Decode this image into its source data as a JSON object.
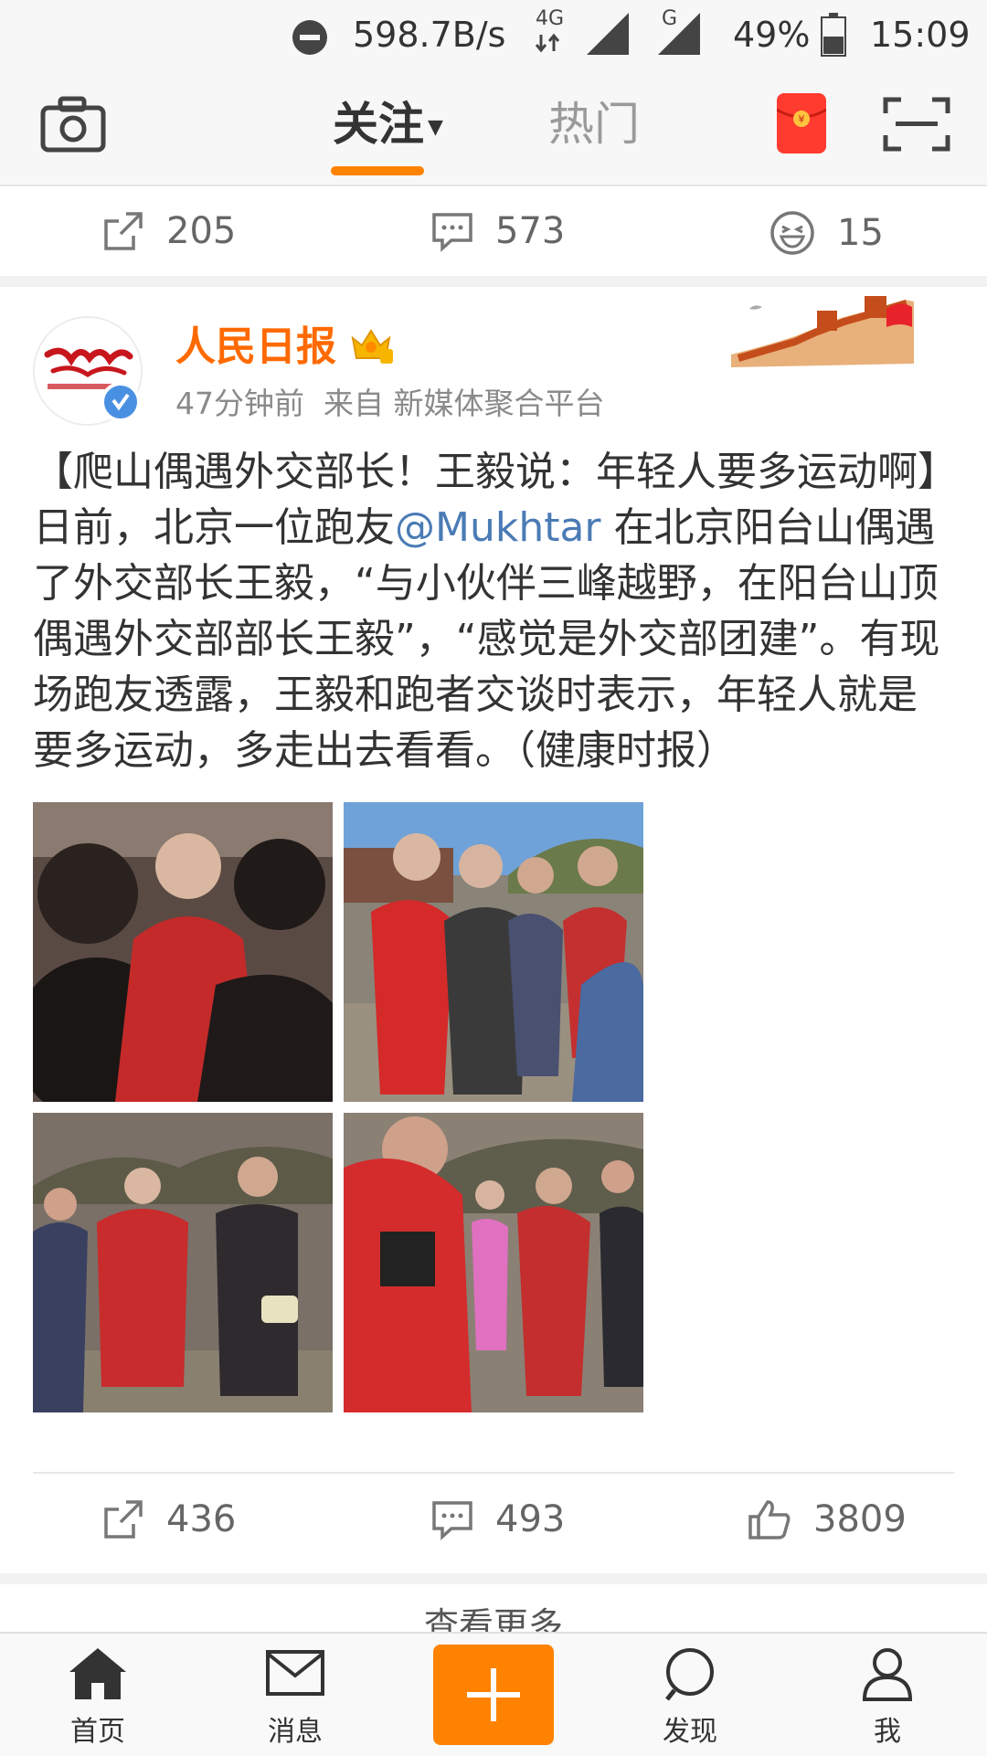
{
  "status_bar": {
    "net_speed": "598.7B/s",
    "network_4g": "4G",
    "network_g": "G",
    "battery": "49%",
    "time": "15:09"
  },
  "top_nav": {
    "tab_follow": "关注",
    "tab_hot": "热门",
    "icons": [
      "camera-icon",
      "red-envelope-icon",
      "scan-icon"
    ]
  },
  "prev_post_actions": {
    "repost": "205",
    "comment": "573",
    "reaction": "15"
  },
  "post": {
    "author": "人民日报",
    "time": "47分钟前",
    "source": "来自 新媒体聚合平台",
    "text_before_mention": "【爬山偶遇外交部长！王毅说：年轻人要多运动啊】日前，北京一位跑友",
    "mention": "@Mukhtar",
    "text_after_mention": " 在北京阳台山偶遇了外交部长王毅，“与小伙伴三峰越野，在阳台山顶偶遇外交部部长王毅”，“感觉是外交部团建”。有现场跑友透露，王毅和跑者交谈时表示，年轻人就是要多运动，多走出去看看。（健康时报）",
    "photo_count": 4,
    "actions": {
      "repost": "436",
      "comment": "493",
      "like": "3809"
    }
  },
  "more_link": "查看更多",
  "bottom_nav": {
    "home": "首页",
    "messages": "消息",
    "discover": "发现",
    "me": "我"
  },
  "colors": {
    "accent": "#ff8200",
    "username": "#ff6a00",
    "mention": "#4a7bb5"
  }
}
